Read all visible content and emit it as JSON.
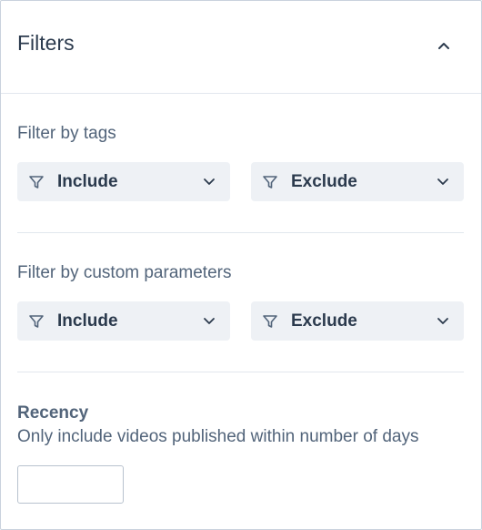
{
  "panel": {
    "title": "Filters"
  },
  "tags": {
    "label": "Filter by tags",
    "include_label": "Include",
    "exclude_label": "Exclude"
  },
  "custom_params": {
    "label": "Filter by custom parameters",
    "include_label": "Include",
    "exclude_label": "Exclude"
  },
  "recency": {
    "title": "Recency",
    "description": "Only include videos published within number of days",
    "days_value": "",
    "days_placeholder": ""
  },
  "icons": {
    "collapse": "chevron-up-icon",
    "filter": "funnel-icon",
    "dropdown": "chevron-down-icon"
  }
}
